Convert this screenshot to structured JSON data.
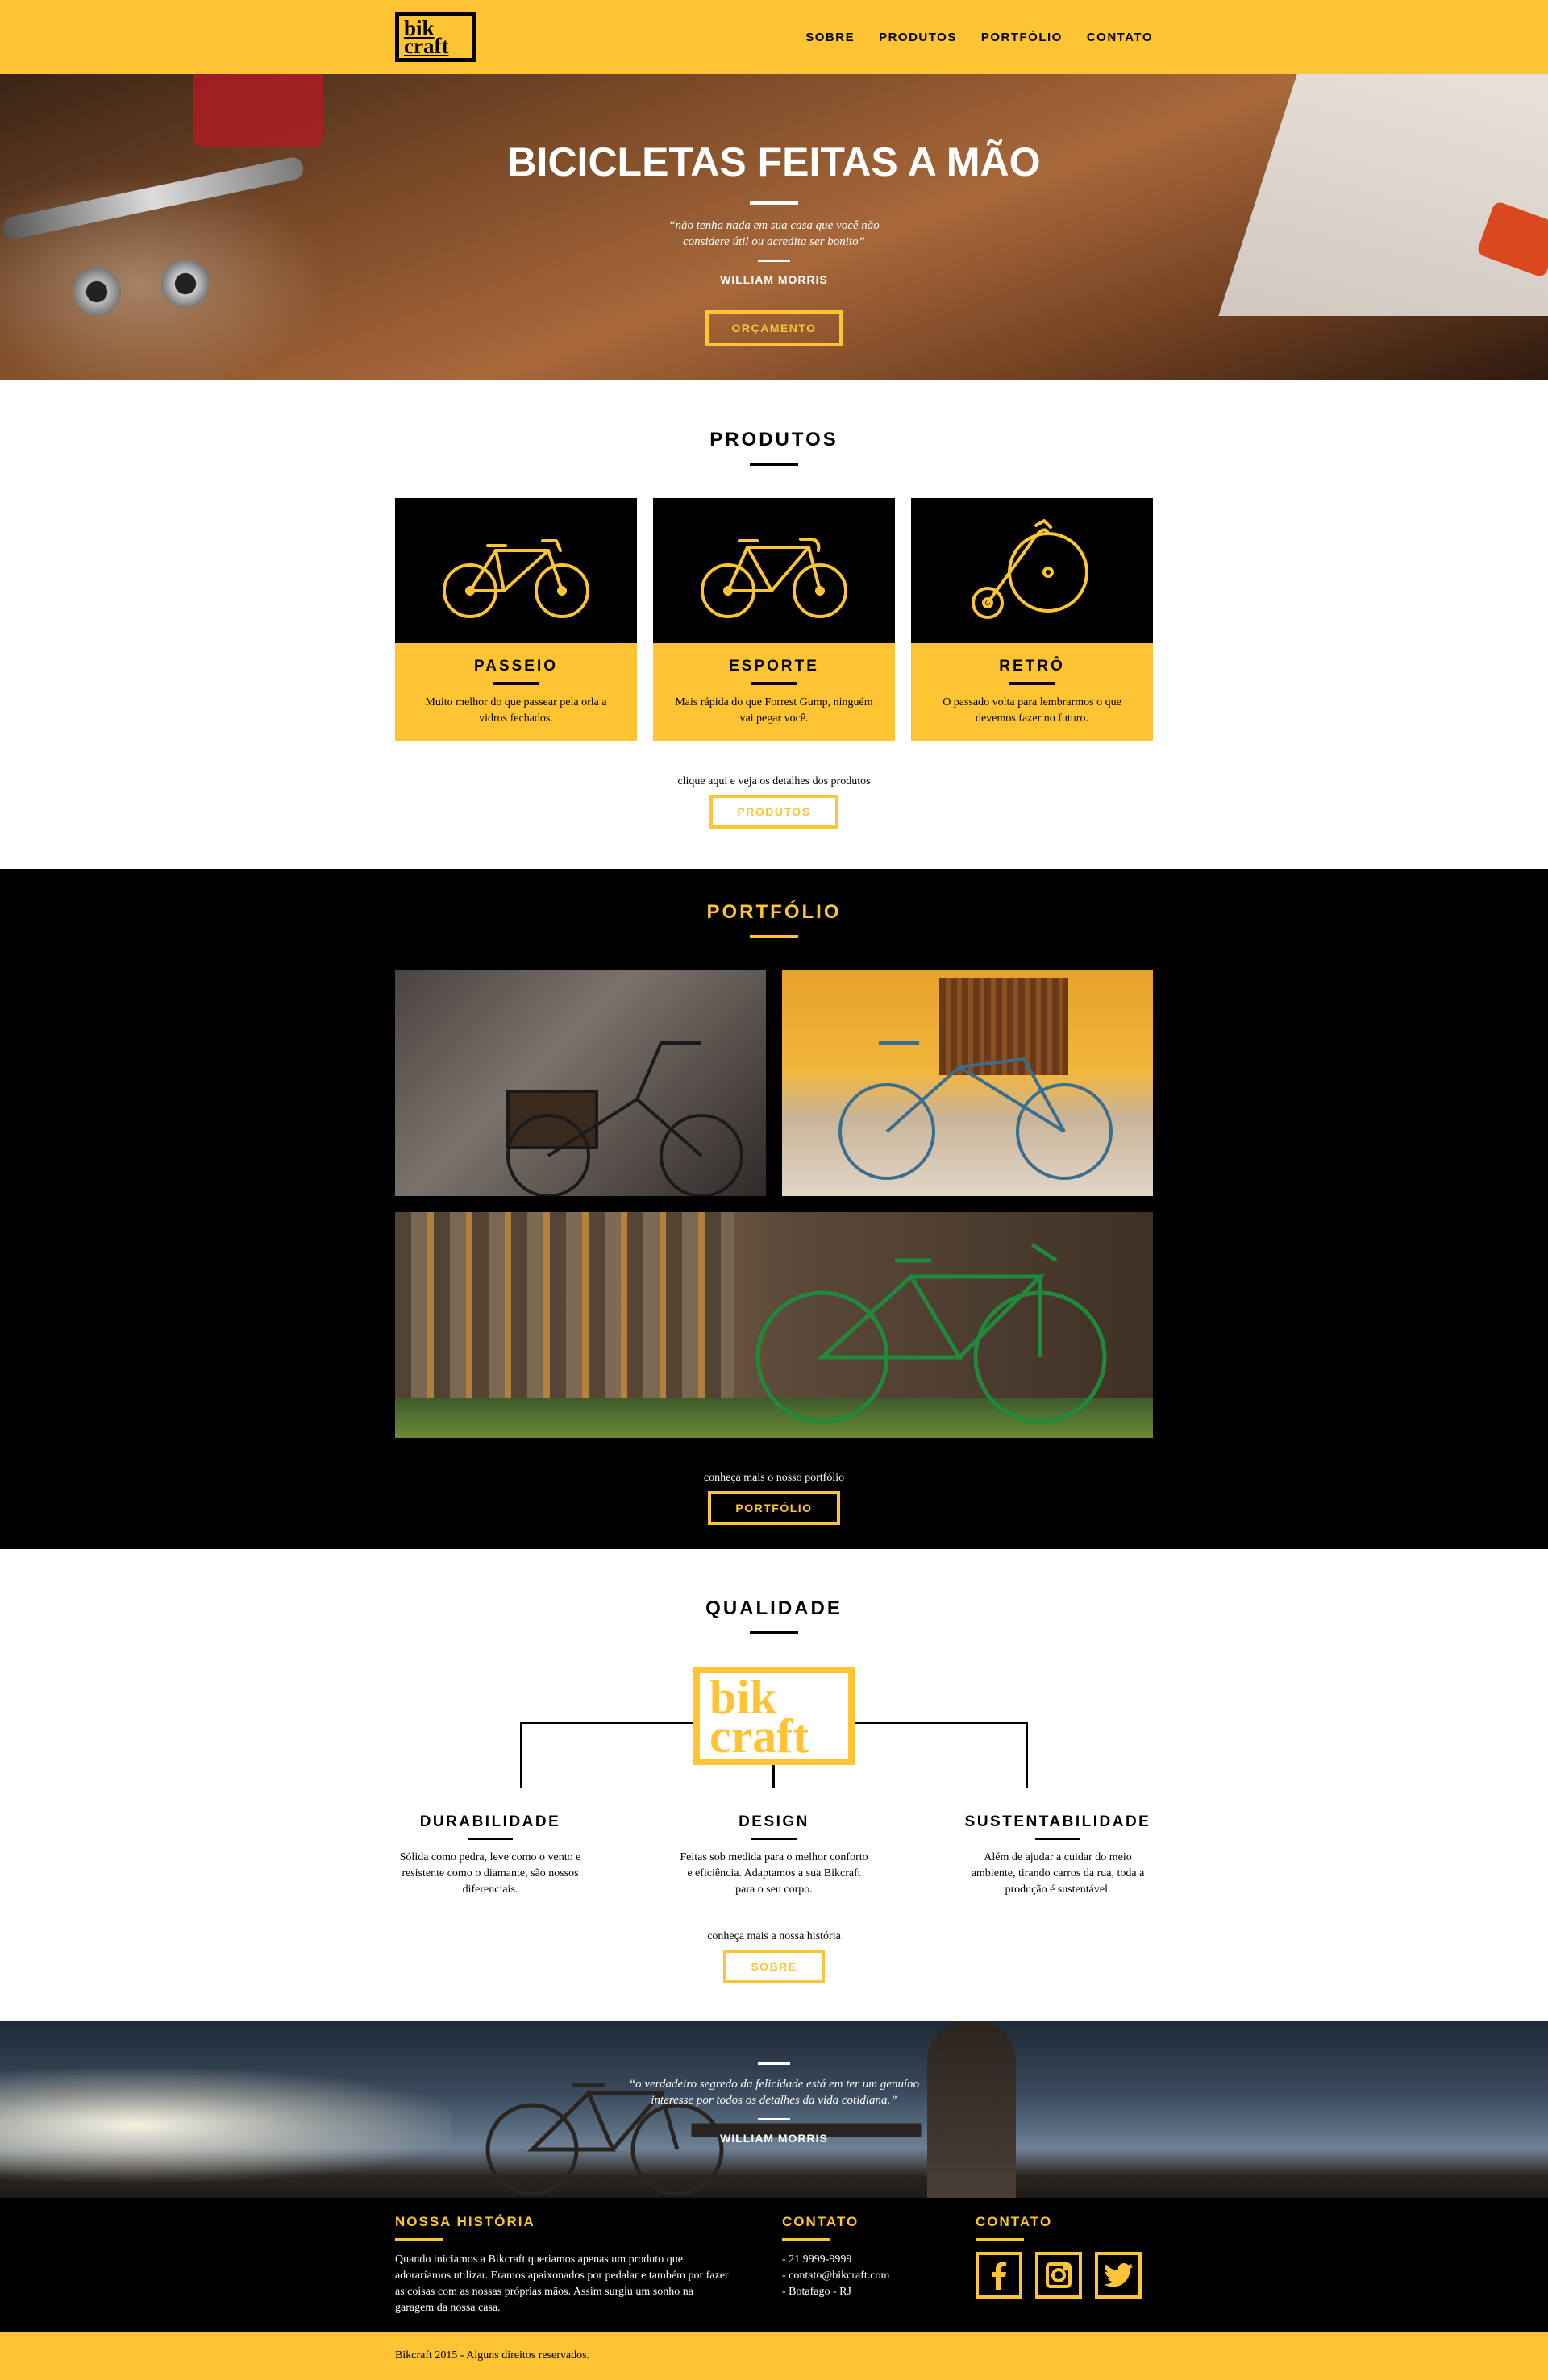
{
  "header": {
    "logo_line1": "bik",
    "logo_line2": "craft",
    "nav": [
      "SOBRE",
      "PRODUTOS",
      "PORTFÓLIO",
      "CONTATO"
    ]
  },
  "hero": {
    "title": "BICICLETAS FEITAS A MÃO",
    "quote": "“não tenha nada em sua casa que você não considere útil ou acredita ser bonito”",
    "author": "WILLIAM MORRIS",
    "button": "ORÇAMENTO"
  },
  "produtos": {
    "title": "PRODUTOS",
    "items": [
      {
        "name": "PASSEIO",
        "desc": "Muito melhor do que passear pela orla a vidros fechados.",
        "icon": "city-bike-icon"
      },
      {
        "name": "ESPORTE",
        "desc": "Mais rápida do que Forrest Gump, ninguém vai pegar você.",
        "icon": "sport-bike-icon"
      },
      {
        "name": "RETRÔ",
        "desc": "O passado volta para lembrarmos o que devemos fazer no futuro.",
        "icon": "penny-farthing-icon"
      }
    ],
    "cta_text": "clique aqui e veja os detalhes dos produtos",
    "button": "PRODUTOS"
  },
  "portfolio": {
    "title": "PORTFÓLIO",
    "cta_text": "conheça mais o nosso portfólio",
    "button": "PORTFÓLIO"
  },
  "qualidade": {
    "title": "QUALIDADE",
    "logo_line1": "bik",
    "logo_line2": "craft",
    "items": [
      {
        "name": "DURABILIDADE",
        "desc": "Sólida como pedra, leve como o vento e resistente como o diamante, são nossos diferenciais."
      },
      {
        "name": "DESIGN",
        "desc": "Feitas sob medida para o melhor conforto e eficiência. Adaptamos a sua Bikcraft para o seu corpo."
      },
      {
        "name": "SUSTENTABILIDADE",
        "desc": "Além de ajudar a cuidar do meio ambiente, tirando carros da rua, toda a produção é sustentável."
      }
    ],
    "cta_text": "conheça mais a nossa história",
    "button": "SOBRE"
  },
  "banner": {
    "quote": "“o verdadeiro segredo da felicidade está em ter um genuíno interesse por todos os detalhes da vida cotidiana.”",
    "author": "WILLIAM MORRIS"
  },
  "footer": {
    "historia_title": "NOSSA HISTÓRIA",
    "historia_text": "Quando iniciamos a Bikcraft queriamos apenas um produto que adoraríamos utilizar. Eramos apaixonados por pedalar e também por fazer as coisas com as nossas próprias mãos. Assim surgiu um sonho na garagem da nossa casa.",
    "contato_title": "CONTATO",
    "contato": [
      "- 21 9999-9999",
      "- contato@bikcraft.com",
      "- Botafago - RJ"
    ],
    "social_title": "CONTATO",
    "social": [
      "facebook-icon",
      "instagram-icon",
      "twitter-icon"
    ]
  },
  "copyright": "Bikcraft 2015 - Alguns direitos reservados.",
  "colors": {
    "accent": "#FEC433",
    "dark": "#000000"
  }
}
